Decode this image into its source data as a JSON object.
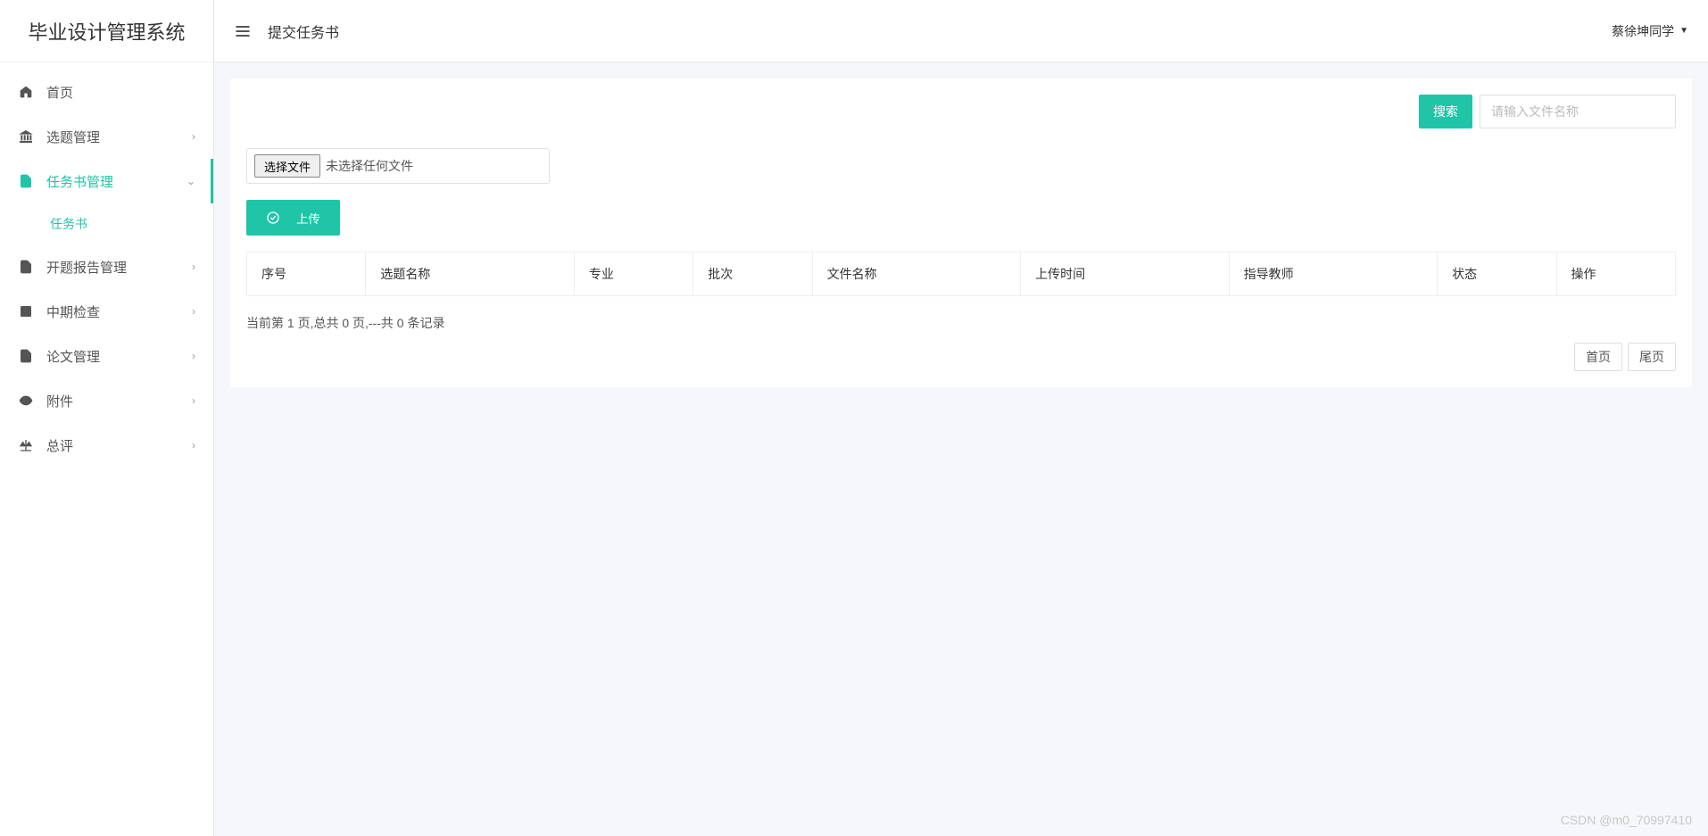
{
  "app": {
    "title": "毕业设计管理系统"
  },
  "header": {
    "page_title": "提交任务书",
    "user_name": "蔡徐坤同学"
  },
  "sidebar": {
    "items": [
      {
        "label": "首页",
        "icon": "home",
        "expandable": false
      },
      {
        "label": "选题管理",
        "icon": "bank",
        "expandable": true
      },
      {
        "label": "任务书管理",
        "icon": "file",
        "expandable": true,
        "expanded": true,
        "children": [
          {
            "label": "任务书"
          }
        ]
      },
      {
        "label": "开题报告管理",
        "icon": "file",
        "expandable": true
      },
      {
        "label": "中期检查",
        "icon": "square",
        "expandable": true
      },
      {
        "label": "论文管理",
        "icon": "doc",
        "expandable": true
      },
      {
        "label": "附件",
        "icon": "attach",
        "expandable": true
      },
      {
        "label": "总评",
        "icon": "scale",
        "expandable": true
      }
    ]
  },
  "search": {
    "button": "搜索",
    "placeholder": "请输入文件名称"
  },
  "file_picker": {
    "button": "选择文件",
    "status": "未选择任何文件"
  },
  "upload": {
    "button": "上传"
  },
  "table": {
    "headers": [
      "序号",
      "选题名称",
      "专业",
      "批次",
      "文件名称",
      "上传时间",
      "指导教师",
      "状态",
      "操作"
    ]
  },
  "pagination": {
    "info": "当前第 1 页,总共 0 页,---共 0 条记录",
    "first": "首页",
    "last": "尾页"
  },
  "watermark": "CSDN @m0_70997410"
}
